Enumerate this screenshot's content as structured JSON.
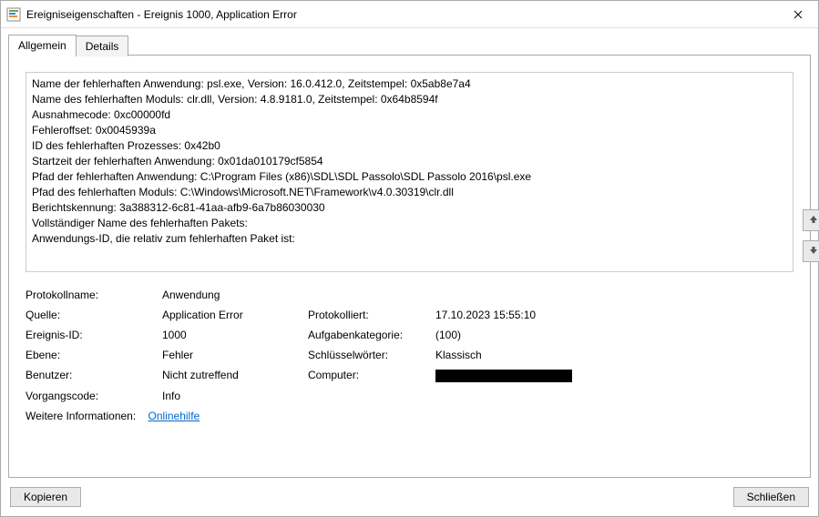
{
  "window": {
    "title": "Ereigniseigenschaften - Ereignis 1000, Application Error"
  },
  "tabs": {
    "general": "Allgemein",
    "details": "Details"
  },
  "message_lines": [
    "Name der fehlerhaften Anwendung: psl.exe, Version: 16.0.412.0, Zeitstempel: 0x5ab8e7a4",
    "Name des fehlerhaften Moduls: clr.dll, Version: 4.8.9181.0, Zeitstempel: 0x64b8594f",
    "Ausnahmecode: 0xc00000fd",
    "Fehleroffset: 0x0045939a",
    "ID des fehlerhaften Prozesses: 0x42b0",
    "Startzeit der fehlerhaften Anwendung: 0x01da010179cf5854",
    "Pfad der fehlerhaften Anwendung: C:\\Program Files (x86)\\SDL\\SDL Passolo\\SDL Passolo 2016\\psl.exe",
    "Pfad des fehlerhaften Moduls: C:\\Windows\\Microsoft.NET\\Framework\\v4.0.30319\\clr.dll",
    "Berichtskennung: 3a388312-6c81-41aa-afb9-6a7b86030030",
    "Vollständiger Name des fehlerhaften Pakets:",
    "Anwendungs-ID, die relativ zum fehlerhaften Paket ist:"
  ],
  "props": {
    "log_label": "Protokollname:",
    "log_value": "Anwendung",
    "source_label": "Quelle:",
    "source_value": "Application Error",
    "logged_label": "Protokolliert:",
    "logged_value": "17.10.2023 15:55:10",
    "eventid_label": "Ereignis-ID:",
    "eventid_value": "1000",
    "taskcat_label": "Aufgabenkategorie:",
    "taskcat_value": "(100)",
    "level_label": "Ebene:",
    "level_value": "Fehler",
    "keywords_label": "Schlüsselwörter:",
    "keywords_value": "Klassisch",
    "user_label": "Benutzer:",
    "user_value": "Nicht zutreffend",
    "computer_label": "Computer:",
    "opcode_label": "Vorgangscode:",
    "opcode_value": "Info",
    "moreinfo_label": "Weitere Informationen:",
    "moreinfo_link": "Onlinehilfe"
  },
  "buttons": {
    "copy": "Kopieren",
    "close": "Schließen"
  }
}
